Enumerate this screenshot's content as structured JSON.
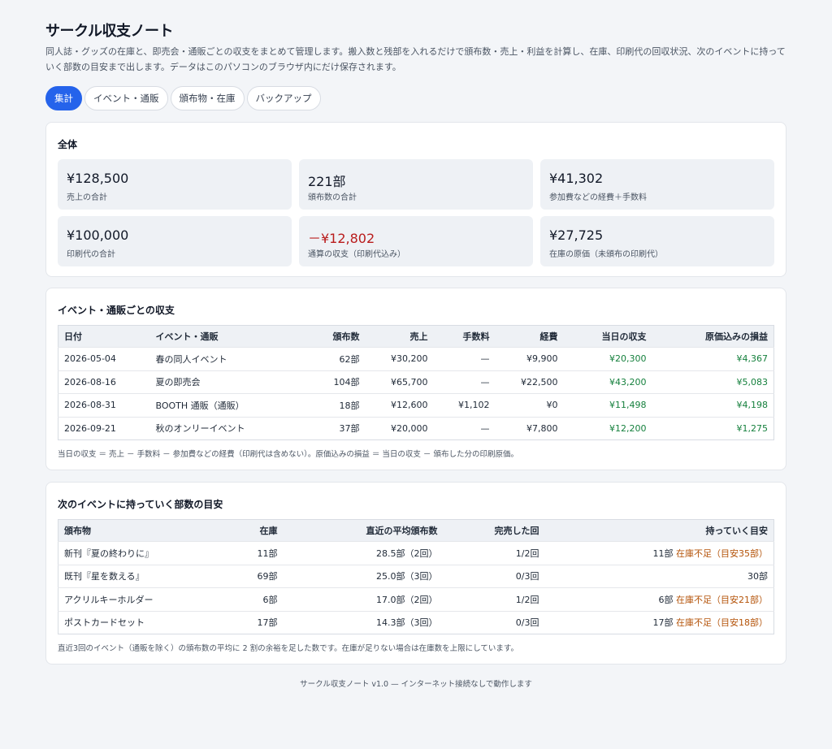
{
  "app": {
    "title": "サークル収支ノート",
    "description": "同人誌・グッズの在庫と、即売会・通販ごとの収支をまとめて管理します。搬入数と残部を入れるだけで頒布数・売上・利益を計算し、在庫、印刷代の回収状況、次のイベントに持っていく部数の目安まで出します。データはこのパソコンのブラウザ内にだけ保存されます。"
  },
  "tabs": [
    {
      "label": "集計",
      "active": true
    },
    {
      "label": "イベント・通販",
      "active": false
    },
    {
      "label": "頒布物・在庫",
      "active": false
    },
    {
      "label": "バックアップ",
      "active": false
    }
  ],
  "summary": {
    "title": "全体",
    "stats": [
      {
        "value": "¥128,500",
        "label": "売上の合計",
        "negative": false
      },
      {
        "value": "221部",
        "label": "頒布数の合計",
        "negative": false
      },
      {
        "value": "¥41,302",
        "label": "参加費などの経費＋手数料",
        "negative": false
      },
      {
        "value": "¥100,000",
        "label": "印刷代の合計",
        "negative": false
      },
      {
        "value": "－¥12,802",
        "label": "通算の収支（印刷代込み）",
        "negative": true
      },
      {
        "value": "¥27,725",
        "label": "在庫の原価（未頒布の印刷代）",
        "negative": false
      }
    ]
  },
  "events": {
    "title": "イベント・通販ごとの収支",
    "columns": [
      "日付",
      "イベント・通販",
      "頒布数",
      "売上",
      "手数料",
      "経費",
      "当日の収支",
      "原価込みの損益"
    ],
    "rows": [
      [
        "2026-05-04",
        "春の同人イベント",
        "62部",
        "¥30,200",
        "—",
        "¥9,900",
        "¥20,300",
        "¥4,367"
      ],
      [
        "2026-08-16",
        "夏の即売会",
        "104部",
        "¥65,700",
        "—",
        "¥22,500",
        "¥43,200",
        "¥5,083"
      ],
      [
        "2026-08-31",
        "BOOTH 通販（通販）",
        "18部",
        "¥12,600",
        "¥1,102",
        "¥0",
        "¥11,498",
        "¥4,198"
      ],
      [
        "2026-09-21",
        "秋のオンリーイベント",
        "37部",
        "¥20,000",
        "—",
        "¥7,800",
        "¥12,200",
        "¥1,275"
      ]
    ],
    "note": "当日の収支 ＝ 売上 － 手数料 － 参加費などの経費（印刷代は含めない）。原価込みの損益 ＝ 当日の収支 － 頒布した分の印刷原価。"
  },
  "plan": {
    "title": "次のイベントに持っていく部数の目安",
    "columns": [
      "頒布物",
      "在庫",
      "直近の平均頒布数",
      "完売した回",
      "持っていく目安"
    ],
    "rows": [
      {
        "item": "新刊『夏の終わりに』",
        "stock": "11部",
        "avg": "28.5部（2回）",
        "soldout": "1/2回",
        "target": "11部",
        "warning": "在庫不足（目安35部）"
      },
      {
        "item": "既刊『星を数える』",
        "stock": "69部",
        "avg": "25.0部（3回）",
        "soldout": "0/3回",
        "target": "30部",
        "warning": ""
      },
      {
        "item": "アクリルキーホルダー",
        "stock": "6部",
        "avg": "17.0部（2回）",
        "soldout": "1/2回",
        "target": "6部",
        "warning": "在庫不足（目安21部）"
      },
      {
        "item": "ポストカードセット",
        "stock": "17部",
        "avg": "14.3部（3回）",
        "soldout": "0/3回",
        "target": "17部",
        "warning": "在庫不足（目安18部）"
      }
    ],
    "note": "直近3回のイベント（通販を除く）の頒布数の平均に 2 割の余裕を足した数です。在庫が足りない場合は在庫数を上限にしています。"
  },
  "footer": "サークル収支ノート v1.0 — インターネット接続なしで動作します",
  "colors": {
    "accent": "#2563eb",
    "positive": "#15803d",
    "negative": "#b91c1c",
    "warning": "#b45309"
  }
}
